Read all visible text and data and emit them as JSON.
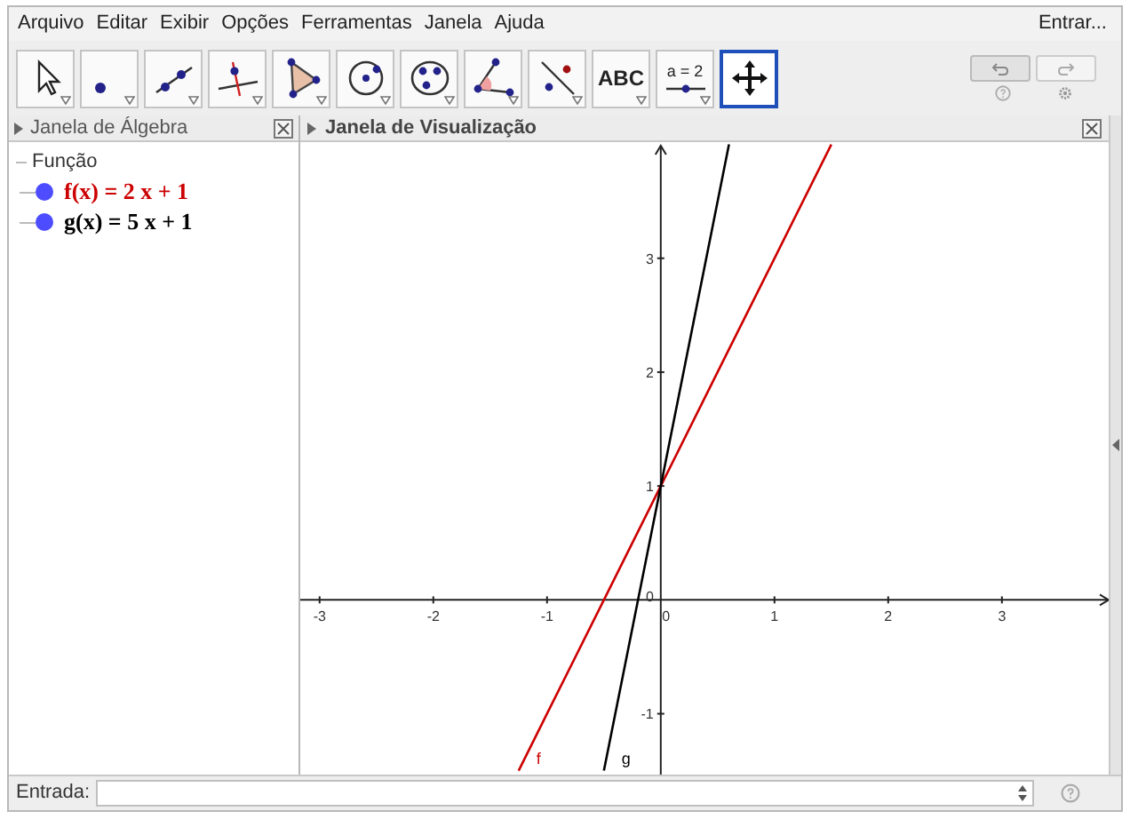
{
  "menu": [
    "Arquivo",
    "Editar",
    "Exibir",
    "Opções",
    "Ferramentas",
    "Janela",
    "Ajuda"
  ],
  "sign_in": "Entrar...",
  "tools": [
    {
      "kind": "move",
      "selected": false
    },
    {
      "kind": "point",
      "selected": false
    },
    {
      "kind": "line",
      "selected": false
    },
    {
      "kind": "perpendicular",
      "selected": false
    },
    {
      "kind": "polygon",
      "selected": false
    },
    {
      "kind": "circle",
      "selected": false
    },
    {
      "kind": "conic",
      "selected": false
    },
    {
      "kind": "angle",
      "selected": false
    },
    {
      "kind": "reflect",
      "selected": false
    },
    {
      "kind": "text",
      "label": "ABC",
      "selected": false
    },
    {
      "kind": "slider",
      "label": "a = 2",
      "selected": false
    },
    {
      "kind": "pan",
      "selected": true
    }
  ],
  "algebra": {
    "title": "Janela de Álgebra",
    "group": "Função",
    "items": [
      {
        "text": "f(x) = 2 x + 1",
        "color": "#cc0000",
        "shown": true
      },
      {
        "text": "g(x) = 5 x + 1",
        "color": "#000000",
        "shown": true
      }
    ]
  },
  "graphics": {
    "title": "Janela de Visualização",
    "chart_data": {
      "type": "line",
      "x": [
        -1.25,
        -1,
        -0.5,
        0,
        0.6,
        1,
        1.5
      ],
      "series": [
        {
          "name": "f",
          "color": "#cc0000",
          "values": [
            -1.5,
            -1,
            0,
            1,
            2.2,
            3,
            4
          ]
        },
        {
          "name": "g",
          "color": "#000000",
          "values": [
            null,
            null,
            -1.5,
            1,
            4,
            null,
            null
          ]
        }
      ],
      "xlim": [
        -3.17,
        3.97
      ],
      "ylim": [
        -1.55,
        4.02
      ],
      "xticks": [
        -3,
        -2,
        -1,
        0,
        1,
        2,
        3
      ],
      "yticks": [
        -1,
        0,
        1,
        2,
        3
      ]
    }
  },
  "input_bar": {
    "label": "Entrada:"
  }
}
